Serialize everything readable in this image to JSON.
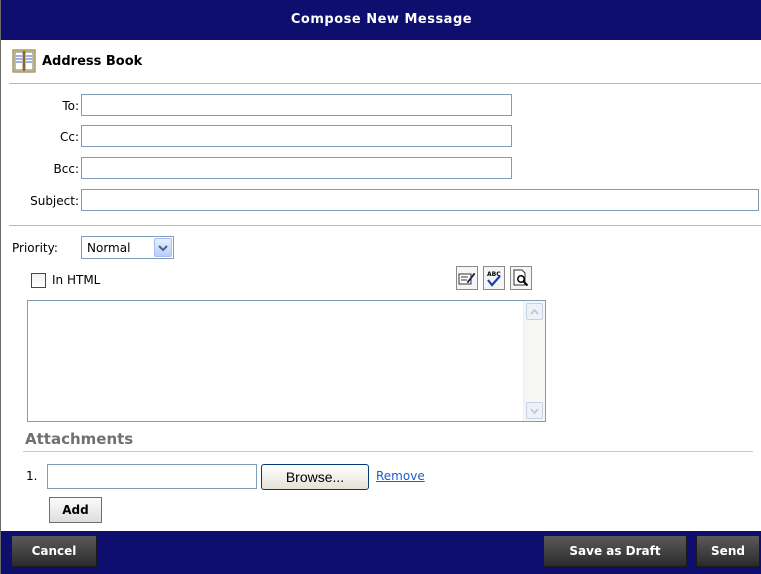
{
  "window": {
    "title": "Compose New Message"
  },
  "address_book": {
    "label": "Address Book",
    "icon": "address-book-icon"
  },
  "fields": {
    "to_label": "To:",
    "to_value": "",
    "cc_label": "Cc:",
    "cc_value": "",
    "bcc_label": "Bcc:",
    "bcc_value": "",
    "subject_label": "Subject:",
    "subject_value": ""
  },
  "priority": {
    "label": "Priority:",
    "value": "Normal"
  },
  "format": {
    "html_label": "In HTML",
    "html_checked": false
  },
  "editor_tools": [
    "edit-icon",
    "spellcheck-icon",
    "preview-icon"
  ],
  "body": {
    "value": ""
  },
  "attachments": {
    "heading": "Attachments",
    "items": [
      {
        "index": "1.",
        "value": "",
        "browse_label": "Browse...",
        "remove_label": "Remove"
      }
    ],
    "add_label": "Add"
  },
  "footer": {
    "cancel_label": "Cancel",
    "save_draft_label": "Save as Draft",
    "send_label": "Send"
  },
  "colors": {
    "title_bar": "#0e0e6e",
    "button": "#3a3a3a",
    "input_border": "#7f9db9",
    "link": "#1e5bd1"
  }
}
